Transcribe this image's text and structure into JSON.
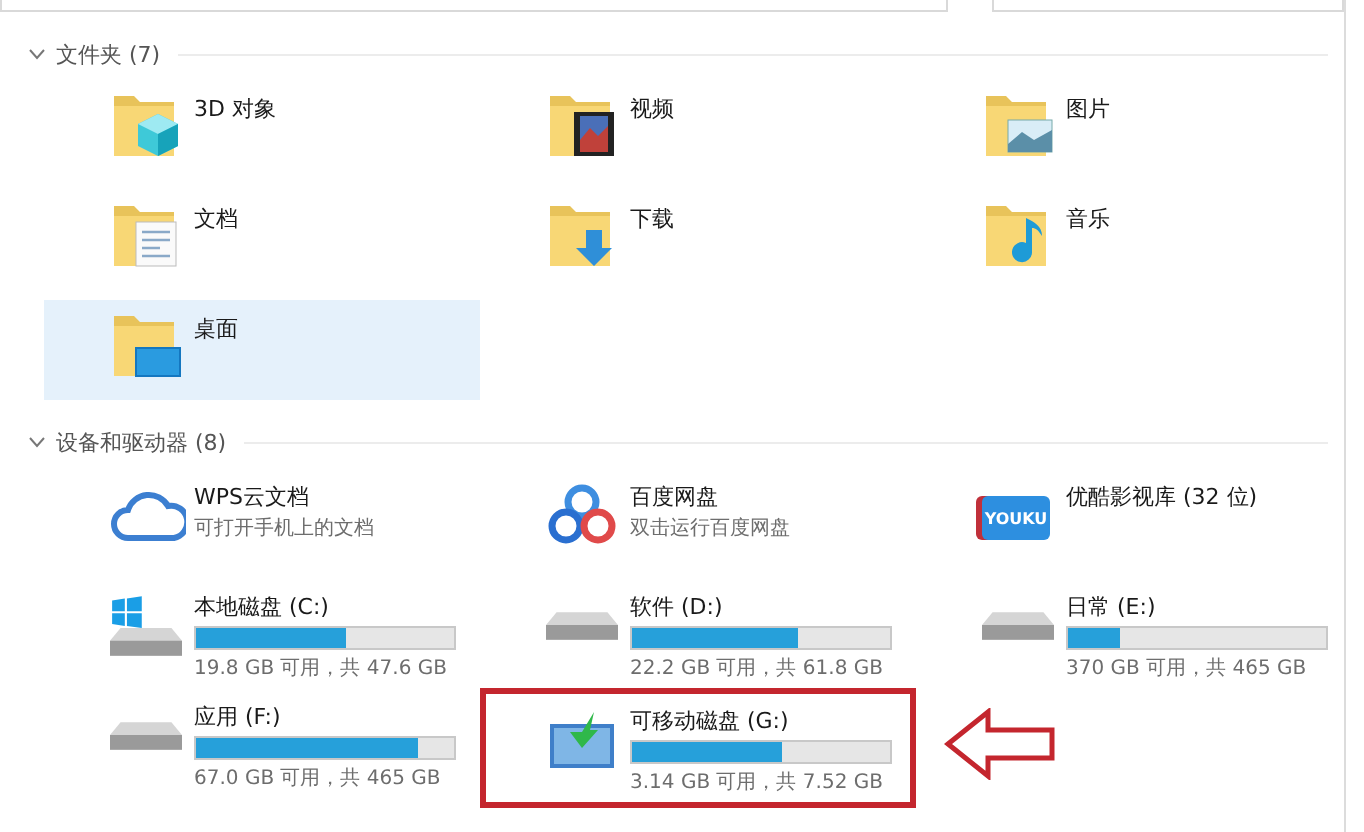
{
  "groups": [
    {
      "title": "文件夹 (7)",
      "expanded": true,
      "items": [
        {
          "kind": "objects",
          "name": "3D 对象",
          "selected": false
        },
        {
          "kind": "videos",
          "name": "视频",
          "selected": false
        },
        {
          "kind": "pictures",
          "name": "图片",
          "selected": false
        },
        {
          "kind": "documents",
          "name": "文档",
          "selected": false
        },
        {
          "kind": "downloads",
          "name": "下载",
          "selected": false
        },
        {
          "kind": "music",
          "name": "音乐",
          "selected": false
        },
        {
          "kind": "desktop",
          "name": "桌面",
          "selected": true
        }
      ]
    },
    {
      "title": "设备和驱动器 (8)",
      "expanded": true,
      "items": [
        {
          "kind": "cloud",
          "name": "WPS云文档",
          "subtitle": "可打开手机上的文档",
          "selected": false,
          "highlighted": false
        },
        {
          "kind": "rings",
          "name": "百度网盘",
          "subtitle": "双击运行百度网盘",
          "selected": false,
          "highlighted": false
        },
        {
          "kind": "youku",
          "name": "优酷影视库 (32 位)",
          "logo_text": "YOUKU",
          "selected": false,
          "highlighted": false
        },
        {
          "kind": "system",
          "name": "本地磁盘 (C:)",
          "level": 0.58,
          "reading": "19.8 GB 可用，共 47.6 GB",
          "selected": false,
          "highlighted": false
        },
        {
          "kind": "drive",
          "name": "软件 (D:)",
          "level": 0.64,
          "reading": "22.2 GB 可用，共 61.8 GB",
          "selected": false,
          "highlighted": false
        },
        {
          "kind": "drive",
          "name": "日常 (E:)",
          "level": 0.2,
          "reading": "370 GB 可用，共 465 GB",
          "selected": false,
          "highlighted": false
        },
        {
          "kind": "drive",
          "name": "应用 (F:)",
          "level": 0.86,
          "reading": "67.0 GB 可用，共 465 GB",
          "selected": false,
          "highlighted": false
        },
        {
          "kind": "removable",
          "name": "可移动磁盘 (G:)",
          "level": 0.58,
          "reading": "3.14 GB 可用，共 7.52 GB",
          "selected": false,
          "highlighted": true
        }
      ]
    }
  ]
}
